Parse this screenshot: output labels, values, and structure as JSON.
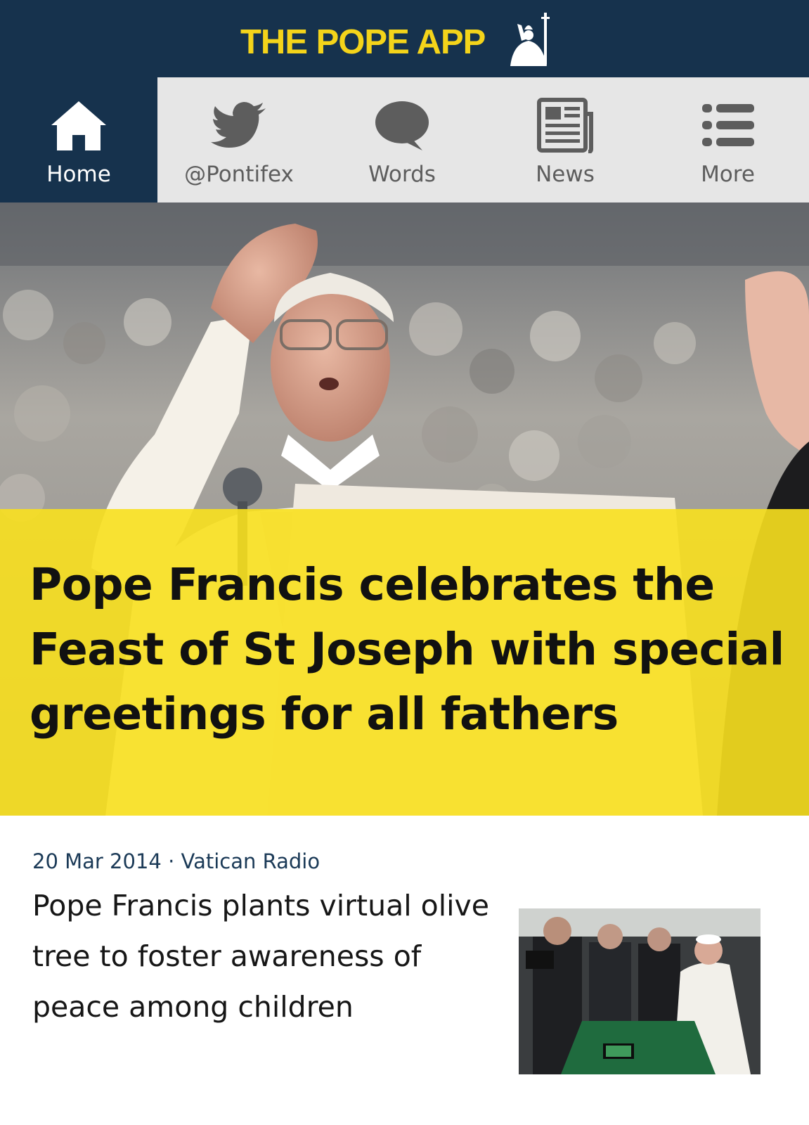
{
  "header": {
    "app_title": "THE POPE APP",
    "logo_icon": "pope-silhouette-icon",
    "background_color": "#16324d",
    "title_color": "#f4d41a"
  },
  "nav": {
    "active_index": 0,
    "items": [
      {
        "label": "Home",
        "icon": "home-icon"
      },
      {
        "label": "@Pontifex",
        "icon": "twitter-bird-icon"
      },
      {
        "label": "Words",
        "icon": "speech-bubble-icon"
      },
      {
        "label": "News",
        "icon": "newspaper-icon"
      },
      {
        "label": "More",
        "icon": "list-icon"
      }
    ]
  },
  "hero": {
    "headline": "Pope Francis celebrates the Feast of St Joseph with special greetings for all fathers",
    "image": "pope-blessing-crowd-photo",
    "band_color": "#f8e01e"
  },
  "articles": [
    {
      "date": "20 Mar 2014",
      "source": "Vatican Radio",
      "separator": "·",
      "title": "Pope Francis plants virtual olive tree to foster awareness of peace among children",
      "thumbnail": "pope-tablet-photo"
    }
  ]
}
